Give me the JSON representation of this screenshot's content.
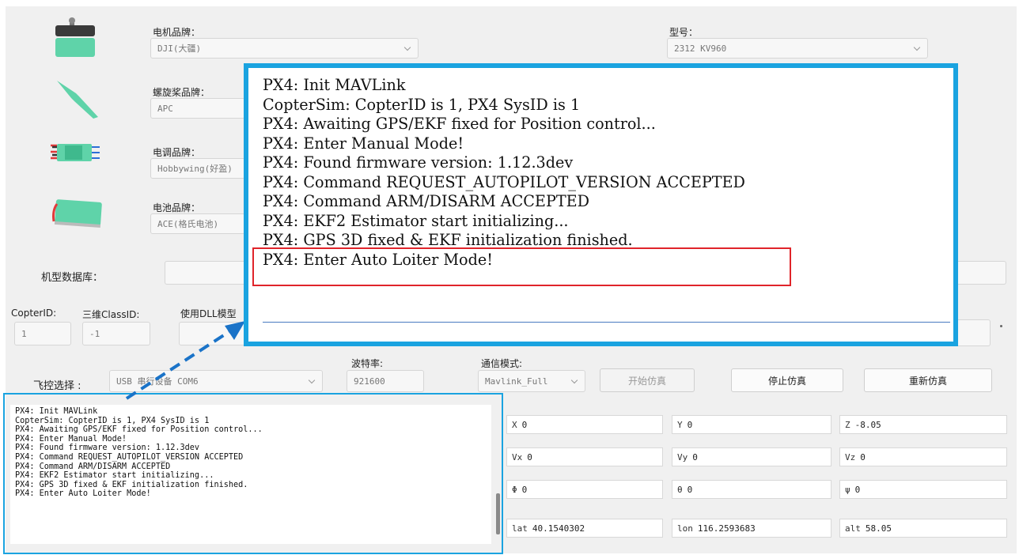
{
  "config": {
    "motor_brand": {
      "label": "电机品牌：",
      "value": "DJI(大疆)"
    },
    "model": {
      "label": "型号：",
      "value": "2312 KV960"
    },
    "prop_brand": {
      "label": "螺旋桨品牌：",
      "value": "APC"
    },
    "esc_brand": {
      "label": "电调品牌：",
      "value": "Hobbywing(好盈)"
    },
    "battery_brand": {
      "label": "电池品牌：",
      "value": "ACE(格氏电池)"
    },
    "model_db": {
      "label": "机型数据库：",
      "value": ""
    }
  },
  "ids": {
    "copter_id_label": "CopterID:",
    "copter_id_value": "1",
    "class_id_label": "三维ClassID:",
    "class_id_value": "-1",
    "dll_label": "使用DLL模型"
  },
  "flight": {
    "fc_label": "飞控选择 :",
    "fc_value": "USB 串行设备 COM6",
    "baud_label": "波特率:",
    "baud_value": "921600",
    "comm_label": "通信模式:",
    "comm_value": "Mavlink_Full",
    "start_button": "开始仿真",
    "stop_button": "停止仿真",
    "restart_button": "重新仿真"
  },
  "log_lines": [
    "PX4: Init MAVLink",
    "CopterSim: CopterID is 1, PX4 SysID is 1",
    "PX4: Awaiting GPS/EKF fixed for Position control...",
    "PX4: Enter Manual Mode!",
    "PX4: Found firmware version: 1.12.3dev",
    "PX4: Command REQUEST_AUTOPILOT_VERSION ACCEPTED",
    "PX4: Command ARM/DISARM ACCEPTED",
    "PX4: EKF2 Estimator start initializing...",
    "PX4: GPS 3D fixed & EKF initialization finished.",
    "PX4: Enter Auto Loiter Mode!"
  ],
  "state": [
    {
      "key": "X",
      "value": "0"
    },
    {
      "key": "Y",
      "value": "0"
    },
    {
      "key": "Z",
      "value": "-8.05"
    },
    {
      "key": "Vx",
      "value": "0"
    },
    {
      "key": "Vy",
      "value": "0"
    },
    {
      "key": "Vz",
      "value": "0"
    },
    {
      "key": "Φ",
      "value": "0"
    },
    {
      "key": "θ",
      "value": "0"
    },
    {
      "key": "ψ",
      "value": "0"
    },
    {
      "key": "lat",
      "value": "40.1540302"
    },
    {
      "key": "lon",
      "value": "116.2593683"
    },
    {
      "key": "alt",
      "value": "58.05"
    }
  ],
  "colors": {
    "highlight_frame": "#1aa3e0",
    "highlight_box": "#e0242a",
    "component_teal": "#5fd3a9"
  }
}
